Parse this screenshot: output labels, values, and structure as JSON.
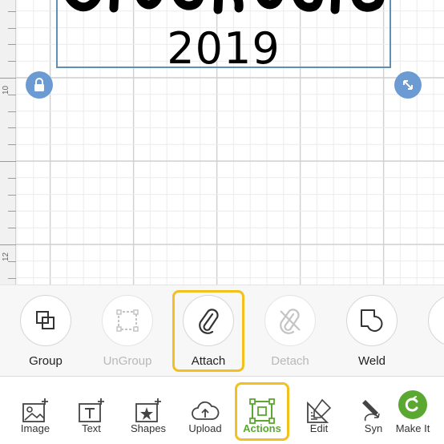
{
  "canvas": {
    "year_text": "2019",
    "ruler_labels": [
      "10",
      "12"
    ]
  },
  "actions": [
    {
      "label": "Group",
      "enabled": true
    },
    {
      "label": "UnGroup",
      "enabled": false
    },
    {
      "label": "Attach",
      "enabled": true,
      "highlighted": true
    },
    {
      "label": "Detach",
      "enabled": false
    },
    {
      "label": "Weld",
      "enabled": true
    }
  ],
  "toolbar": [
    {
      "label": "Image"
    },
    {
      "label": "Text"
    },
    {
      "label": "Shapes"
    },
    {
      "label": "Upload"
    },
    {
      "label": "Actions",
      "active": true
    },
    {
      "label": "Edit"
    },
    {
      "label": "Syn"
    },
    {
      "label": "Make It"
    }
  ],
  "colors": {
    "highlight": "#f2c11f",
    "accent_green": "#5aa832",
    "handle_blue": "#6b9bd2",
    "design_border": "#5f8fb4"
  }
}
